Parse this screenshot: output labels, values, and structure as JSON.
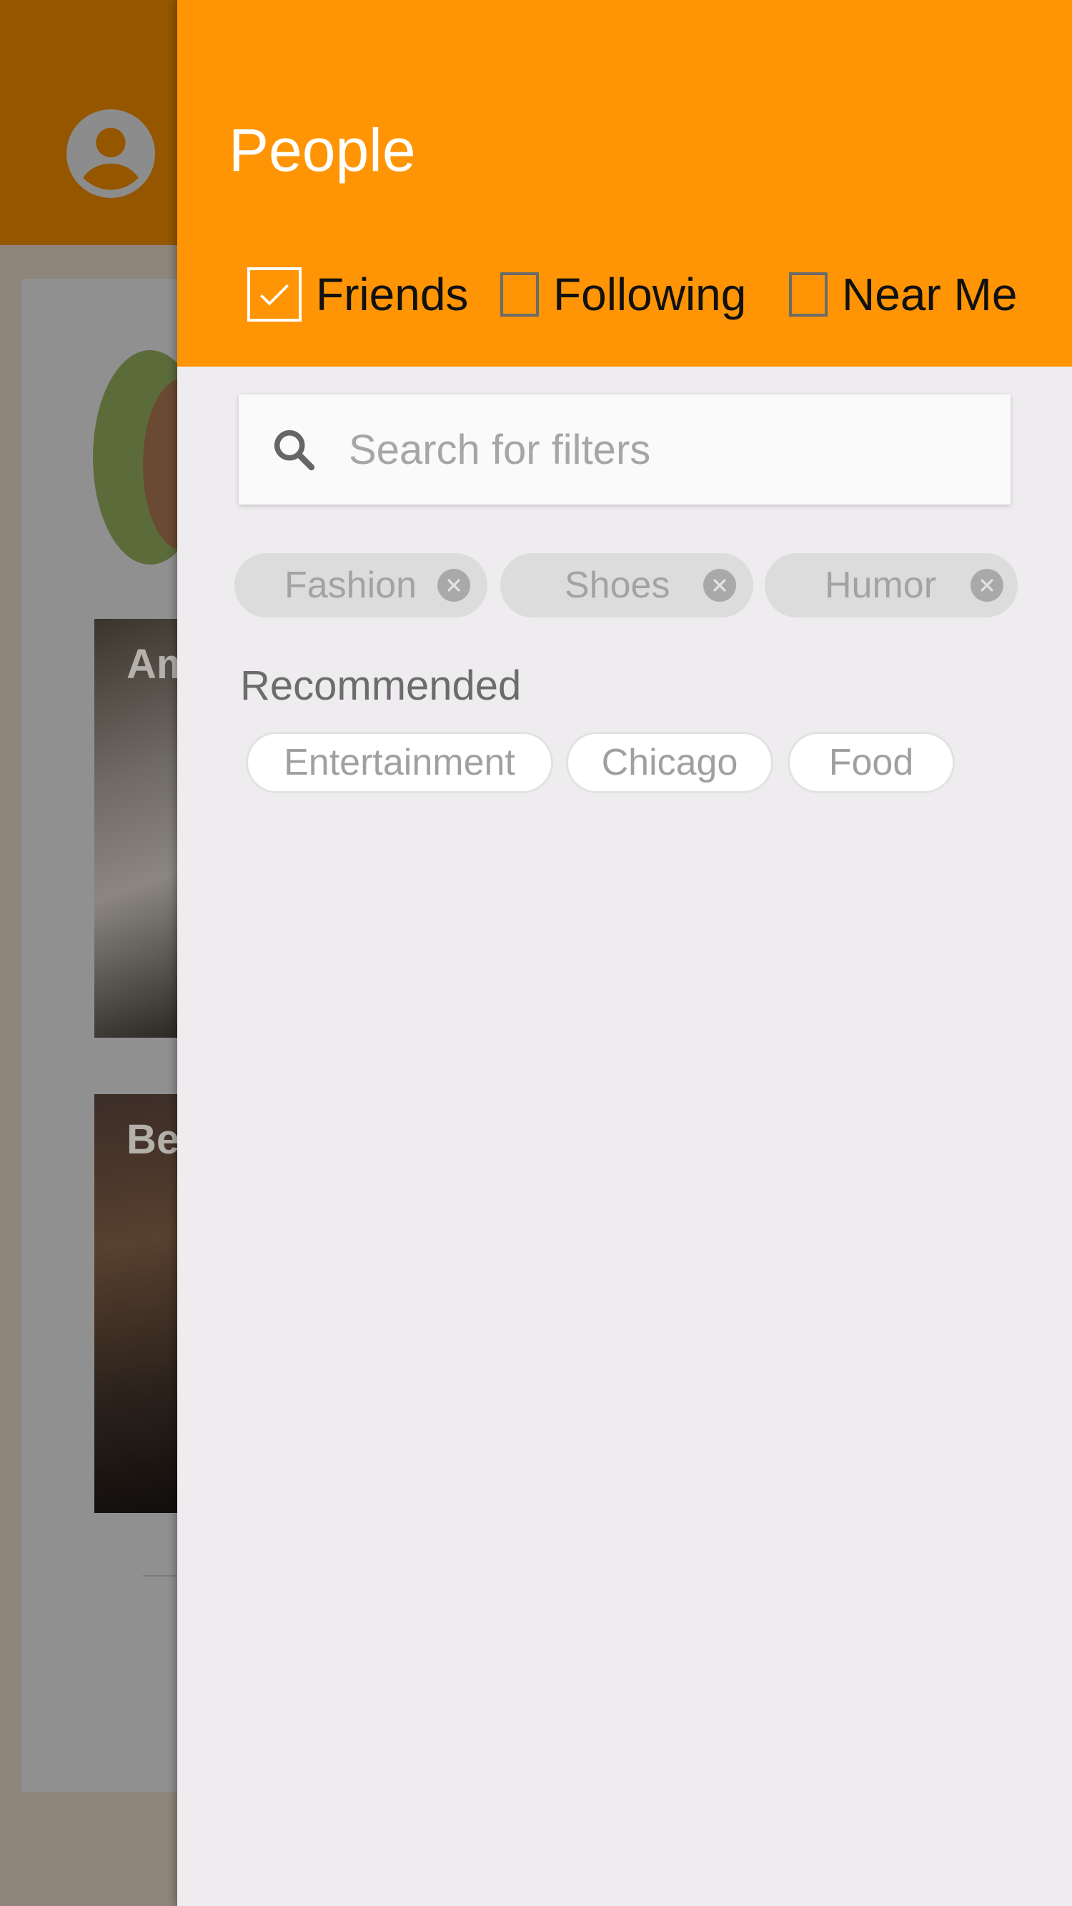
{
  "background": {
    "avatar_icon": "account-circle-icon",
    "tiles": [
      {
        "label": "Am"
      },
      {
        "label": "Be"
      }
    ]
  },
  "drawer": {
    "title": "People",
    "filters": [
      {
        "label": "Friends",
        "checked": true
      },
      {
        "label": "Following",
        "checked": false
      },
      {
        "label": "Near Me",
        "checked": false
      }
    ],
    "search": {
      "icon": "search-icon",
      "placeholder": "Search for filters",
      "value": ""
    },
    "active_tags": [
      {
        "label": "Fashion",
        "remove_icon": "close-circle-icon"
      },
      {
        "label": "Shoes",
        "remove_icon": "close-circle-icon"
      },
      {
        "label": "Humor",
        "remove_icon": "close-circle-icon"
      }
    ],
    "recommended_title": "Recommended",
    "recommended_tags": [
      {
        "label": "Entertainment"
      },
      {
        "label": "Chicago"
      },
      {
        "label": "Food"
      }
    ]
  },
  "colors": {
    "header": "#ff9505",
    "drawer_background": "#eeecee",
    "scrim_topbar": "#955600"
  }
}
